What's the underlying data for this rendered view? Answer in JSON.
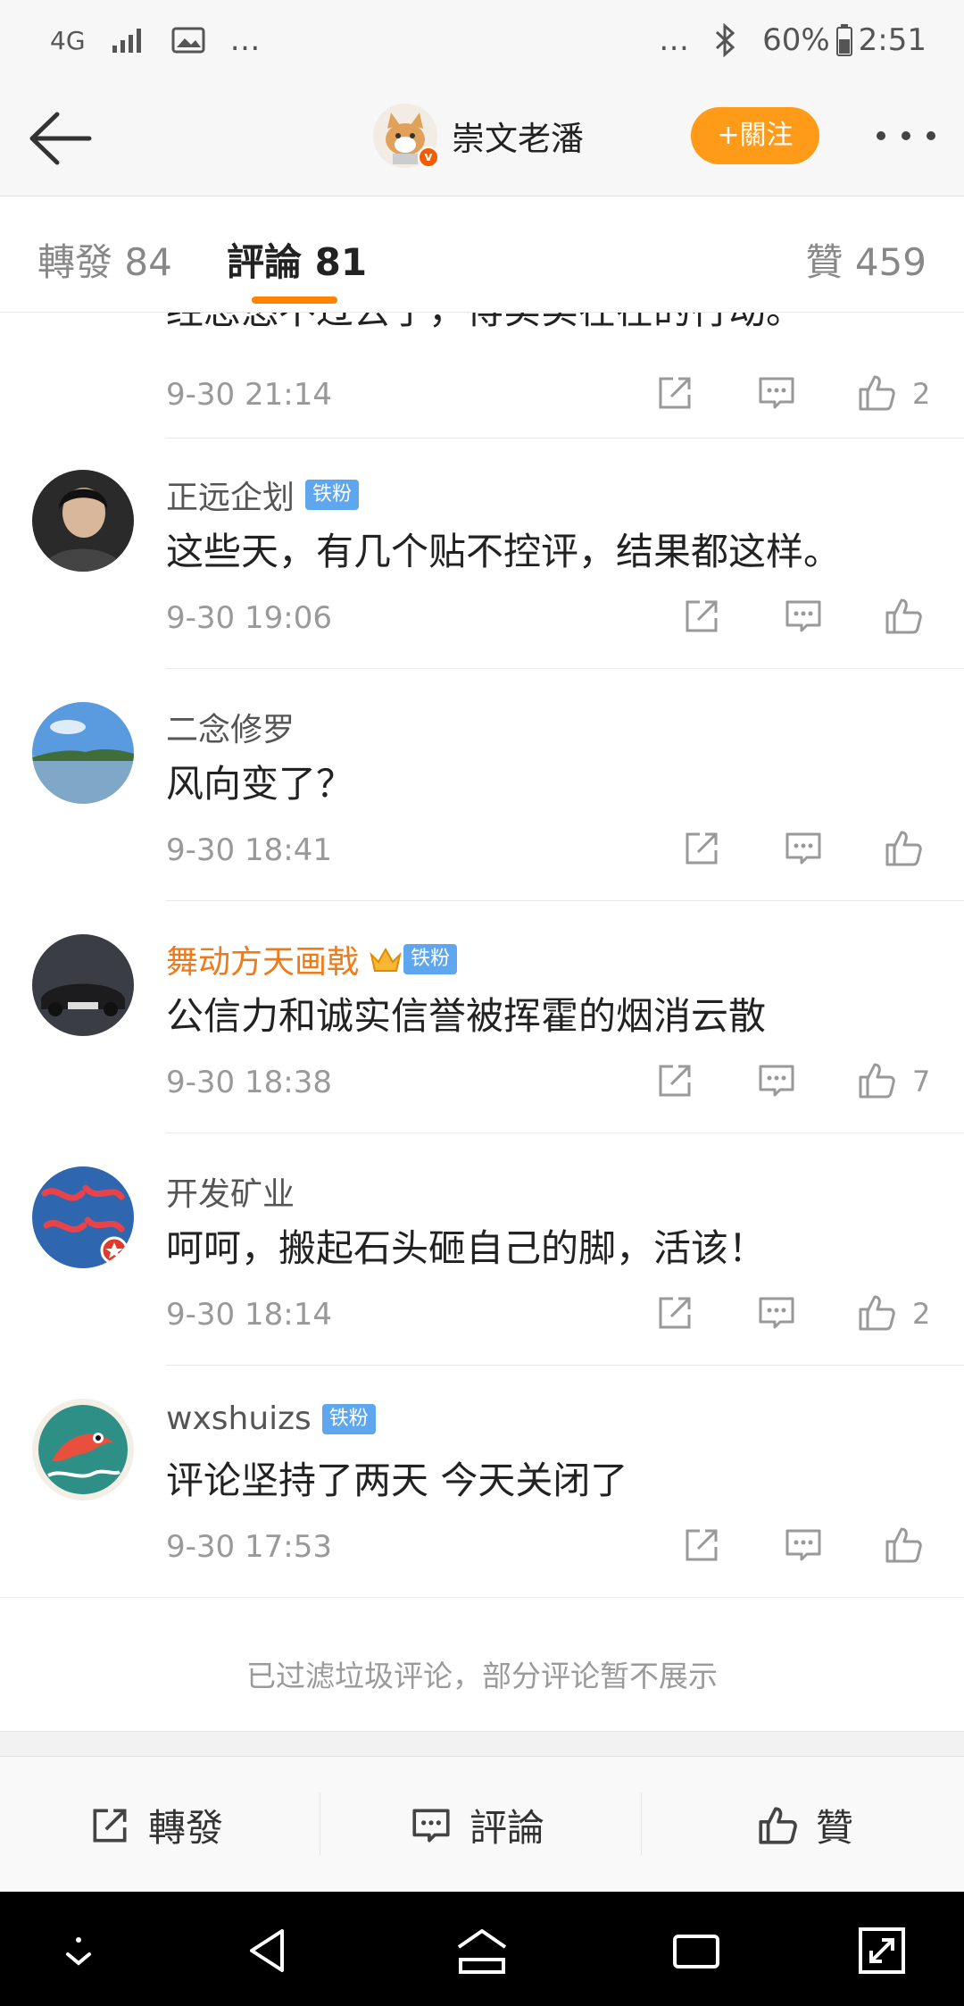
{
  "status_bar": {
    "network": "4G",
    "left_extra": "…",
    "right_extra": "…",
    "battery": "60%",
    "time": "2:51"
  },
  "nav": {
    "title": "崇文老潘",
    "follow_label": "+關注",
    "verified_badge": "v"
  },
  "tabs": {
    "forward": "轉發 84",
    "comment": "評論 81",
    "like": "贊 459"
  },
  "cut_comment": {
    "content": "经忽悠不过去了，得实实在在的行动。",
    "time": "9-30 21:14",
    "likes": "2"
  },
  "comments": [
    {
      "name": "正远企划",
      "badge": "铁粉",
      "content": "这些天，有几个贴不控评，结果都这样。",
      "time": "9-30 19:06",
      "likes": ""
    },
    {
      "name": "二念修罗",
      "badge": "",
      "content": "风向变了？",
      "time": "9-30 18:41",
      "likes": ""
    },
    {
      "name": "舞动方天画戟",
      "badge": "铁粉",
      "content": "公信力和诚实信誉被挥霍的烟消云散",
      "time": "9-30 18:38",
      "likes": "7"
    },
    {
      "name": "开发矿业",
      "badge": "",
      "content": "呵呵，搬起石头砸自己的脚，活该！",
      "time": "9-30 18:14",
      "likes": "2"
    },
    {
      "name": "wxshuizs",
      "badge": "铁粉",
      "content": "评论坚持了两天 今天关闭了",
      "time": "9-30 17:53",
      "likes": ""
    }
  ],
  "footer_note": "已过滤垃圾评论，部分评论暂不展示",
  "bottom_bar": {
    "forward": "轉發",
    "comment": "評論",
    "like": "贊"
  },
  "colors": {
    "accent": "#ff8200",
    "follow_button": "#ff9b19",
    "badge": "#5ea7ee",
    "vip_name": "#f07a1a"
  }
}
